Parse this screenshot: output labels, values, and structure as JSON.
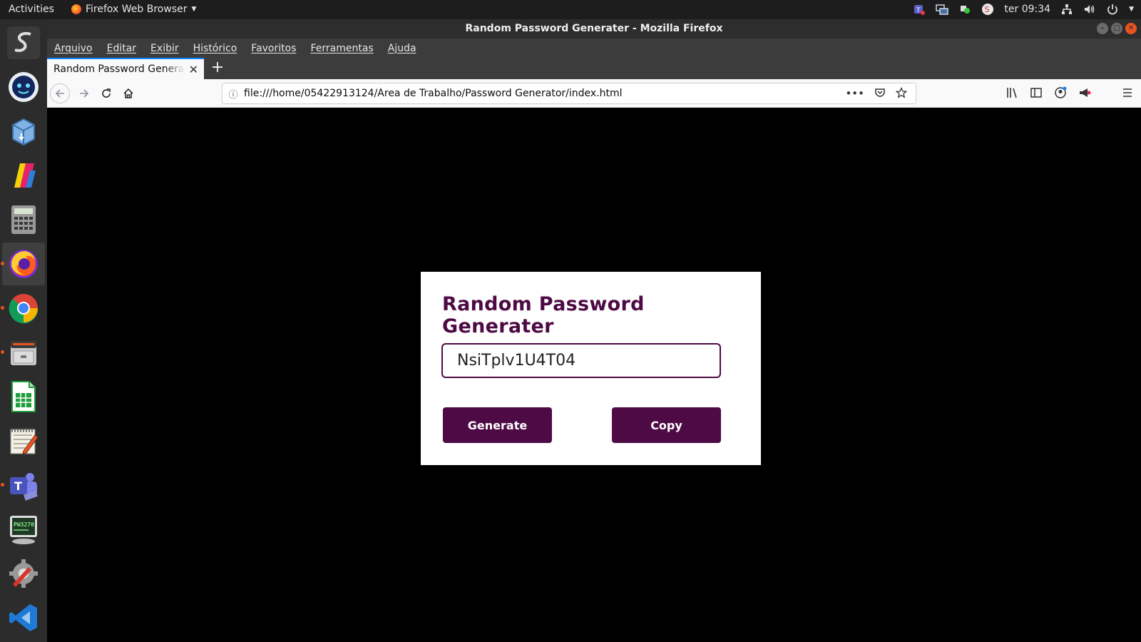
{
  "system": {
    "activities": "Activities",
    "app_menu": "Firefox Web Browser",
    "clock": "ter 09:34"
  },
  "window": {
    "title": "Random Password Generater - Mozilla Firefox"
  },
  "menubar": [
    "Arquivo",
    "Editar",
    "Exibir",
    "Histórico",
    "Favoritos",
    "Ferramentas",
    "Ajuda"
  ],
  "tab": {
    "title": "Random Password Generater"
  },
  "navbar": {
    "url": "file:///home/05422913124/Área de Trabalho/Password Generator/index.html"
  },
  "dock": [
    {
      "name": "dock-item-1",
      "icon": "s-logo-icon",
      "color": "#3a3a3a"
    },
    {
      "name": "dock-item-2",
      "icon": "assistant-icon",
      "color": "#1a3d7a"
    },
    {
      "name": "dock-item-3",
      "icon": "package-icon",
      "color": "#4a8bd6"
    },
    {
      "name": "dock-item-4",
      "icon": "paint-icon",
      "color": "#d63a8b"
    },
    {
      "name": "dock-item-5",
      "icon": "calculator-icon",
      "color": "#5a5a5a"
    },
    {
      "name": "dock-item-firefox",
      "icon": "firefox-icon",
      "color": "#ff7a1a"
    },
    {
      "name": "dock-item-chrome",
      "icon": "chrome-icon",
      "color": "#2a8b3a"
    },
    {
      "name": "dock-item-files",
      "icon": "file-cabinet-icon",
      "color": "#8a8a8a"
    },
    {
      "name": "dock-item-calc",
      "icon": "spreadsheet-icon",
      "color": "#1f9d3a"
    },
    {
      "name": "dock-item-editor",
      "icon": "text-editor-icon",
      "color": "#d9d2b4"
    },
    {
      "name": "dock-item-teams",
      "icon": "teams-icon",
      "color": "#5b5fc7"
    },
    {
      "name": "dock-item-terminal",
      "icon": "terminal-icon",
      "color": "#2f4a2f"
    },
    {
      "name": "dock-item-settings",
      "icon": "settings-icon",
      "color": "#6a6a6a"
    },
    {
      "name": "dock-item-vscode",
      "icon": "vscode-icon",
      "color": "#1f7ad6"
    }
  ],
  "app": {
    "heading": "Random Password Generater",
    "password": "NsiTplv1U4T04",
    "generate_label": "Generate",
    "copy_label": "Copy"
  },
  "colors": {
    "accent": "#4d0a44",
    "background": "#000000",
    "card": "#ffffff"
  }
}
